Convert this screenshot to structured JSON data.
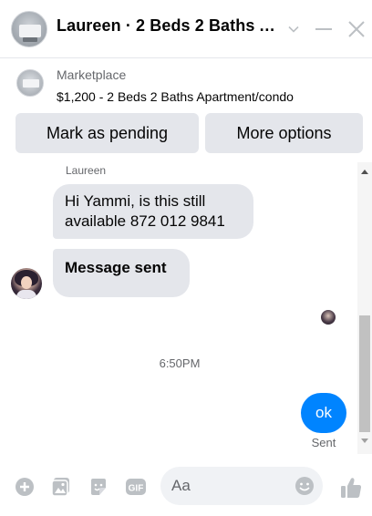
{
  "header": {
    "title": "Laureen · 2 Beds 2 Baths A...",
    "icons": [
      "chevron-down-icon",
      "minimize-icon",
      "close-icon"
    ]
  },
  "marketplace": {
    "label": "Marketplace",
    "listing": "$1,200 - 2 Beds 2 Baths Apartment/condo",
    "buttons": {
      "pending": "Mark as pending",
      "more": "More options"
    }
  },
  "conversation": {
    "sender_name": "Laureen",
    "incoming": [
      "Hi Yammi, is this still available 872 012 9841",
      "Message sent"
    ],
    "timestamp": "6:50PM",
    "outgoing": "ok",
    "status": "Sent"
  },
  "composer": {
    "placeholder": "Aa",
    "icons": [
      "plus-icon",
      "image-icon",
      "sticker-icon",
      "gif-icon",
      "emoji-icon",
      "thumbs-up-icon"
    ]
  },
  "colors": {
    "accent": "#0084ff",
    "bubble_gray": "#e4e6eb",
    "icon_gray": "#bcc0c4"
  }
}
